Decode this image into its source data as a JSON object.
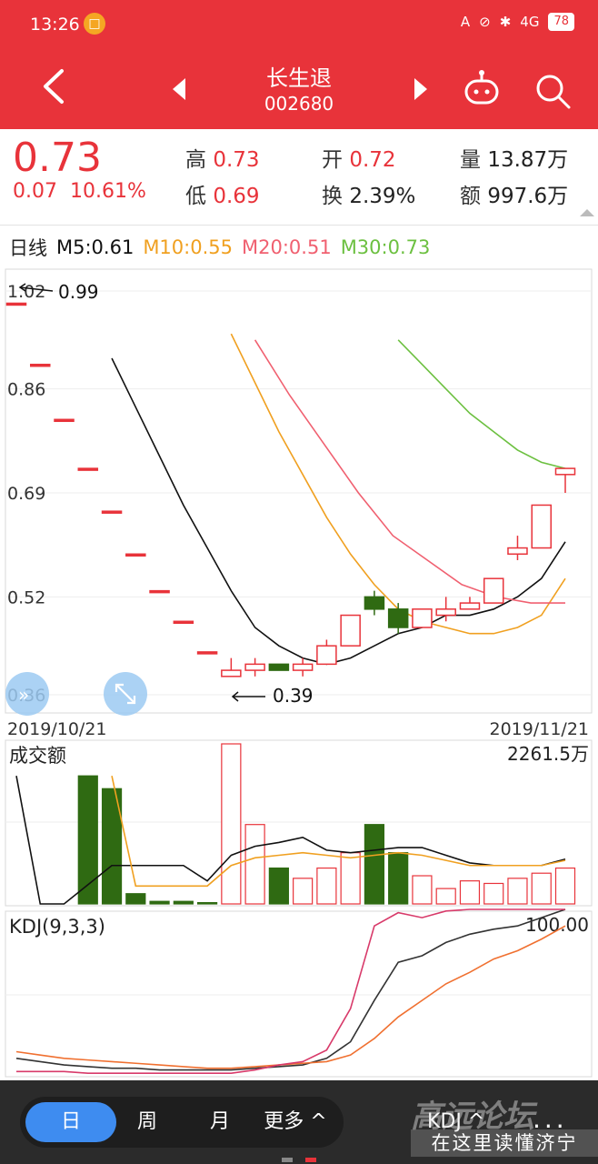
{
  "status_bar": {
    "time": "13:26",
    "battery": "78",
    "network": "4G"
  },
  "header": {
    "title": "长生退",
    "code": "002680"
  },
  "quote": {
    "price": "0.73",
    "change": "0.07",
    "change_pct": "10.61%",
    "high_label": "高",
    "high_value": "0.73",
    "low_label": "低",
    "low_value": "0.69",
    "open_label": "开",
    "open_value": "0.72",
    "turnover_label": "换",
    "turnover_value": "2.39%",
    "volume_label": "量",
    "volume_value": "13.87万",
    "amount_label": "额",
    "amount_value": "997.6万"
  },
  "ma_legend": {
    "period": "日线",
    "m5": "M5:0.61",
    "m10": "M10:0.55",
    "m20": "M20:0.51",
    "m30": "M30:0.73"
  },
  "colors": {
    "up": "#e8333a",
    "down": "#2f6a12",
    "m5": "#111111",
    "m10": "#f0a020",
    "m20": "#f06070",
    "m30": "#6cc040",
    "k": "#333333",
    "d": "#f07030",
    "j": "#d83a6a",
    "accent": "#3e8cf0"
  },
  "chart_data": {
    "type": "candlestick",
    "price_axis": {
      "ticks": [
        "1.02",
        "0.86",
        "0.69",
        "0.52",
        "0.36"
      ],
      "ylim": [
        0.36,
        1.02
      ]
    },
    "annotations": {
      "max_label": "0.99",
      "min_label": "0.39"
    },
    "dates": {
      "start": "2019/10/21",
      "end": "2019/11/21"
    },
    "candles": [
      {
        "o": 1.0,
        "h": 1.0,
        "l": 1.0,
        "c": 1.0
      },
      {
        "o": 0.9,
        "h": 0.9,
        "l": 0.9,
        "c": 0.9
      },
      {
        "o": 0.81,
        "h": 0.81,
        "l": 0.81,
        "c": 0.81
      },
      {
        "o": 0.73,
        "h": 0.73,
        "l": 0.73,
        "c": 0.73
      },
      {
        "o": 0.66,
        "h": 0.66,
        "l": 0.66,
        "c": 0.66
      },
      {
        "o": 0.59,
        "h": 0.59,
        "l": 0.59,
        "c": 0.59
      },
      {
        "o": 0.53,
        "h": 0.53,
        "l": 0.53,
        "c": 0.53
      },
      {
        "o": 0.48,
        "h": 0.48,
        "l": 0.48,
        "c": 0.48
      },
      {
        "o": 0.43,
        "h": 0.43,
        "l": 0.43,
        "c": 0.43
      },
      {
        "o": 0.39,
        "h": 0.42,
        "l": 0.39,
        "c": 0.4
      },
      {
        "o": 0.4,
        "h": 0.42,
        "l": 0.39,
        "c": 0.41
      },
      {
        "o": 0.41,
        "h": 0.41,
        "l": 0.4,
        "c": 0.4
      },
      {
        "o": 0.4,
        "h": 0.42,
        "l": 0.39,
        "c": 0.41
      },
      {
        "o": 0.41,
        "h": 0.45,
        "l": 0.41,
        "c": 0.44
      },
      {
        "o": 0.44,
        "h": 0.49,
        "l": 0.44,
        "c": 0.49
      },
      {
        "o": 0.52,
        "h": 0.53,
        "l": 0.49,
        "c": 0.5
      },
      {
        "o": 0.5,
        "h": 0.51,
        "l": 0.46,
        "c": 0.47
      },
      {
        "o": 0.47,
        "h": 0.5,
        "l": 0.47,
        "c": 0.5
      },
      {
        "o": 0.49,
        "h": 0.52,
        "l": 0.48,
        "c": 0.5
      },
      {
        "o": 0.5,
        "h": 0.52,
        "l": 0.5,
        "c": 0.51
      },
      {
        "o": 0.51,
        "h": 0.55,
        "l": 0.51,
        "c": 0.55
      },
      {
        "o": 0.59,
        "h": 0.62,
        "l": 0.58,
        "c": 0.6
      },
      {
        "o": 0.6,
        "h": 0.67,
        "l": 0.6,
        "c": 0.67
      },
      {
        "o": 0.72,
        "h": 0.73,
        "l": 0.69,
        "c": 0.73
      }
    ],
    "ma5": [
      null,
      null,
      null,
      null,
      0.91,
      0.83,
      0.75,
      0.67,
      0.6,
      0.53,
      0.47,
      0.44,
      0.42,
      0.41,
      0.42,
      0.44,
      0.46,
      0.47,
      0.49,
      0.49,
      0.5,
      0.52,
      0.55,
      0.61
    ],
    "ma10": [
      null,
      null,
      null,
      null,
      null,
      null,
      null,
      null,
      null,
      0.95,
      0.87,
      0.79,
      0.72,
      0.65,
      0.59,
      0.54,
      0.5,
      0.48,
      0.47,
      0.46,
      0.46,
      0.47,
      0.49,
      0.55
    ],
    "ma20": [
      null,
      null,
      null,
      null,
      null,
      null,
      null,
      null,
      null,
      null,
      null,
      null,
      null,
      null,
      null,
      null,
      null,
      null,
      null,
      0.94,
      0.85,
      0.77,
      0.69,
      0.62,
      0.58,
      0.54,
      0.52,
      0.51,
      0.51
    ],
    "ma30": [
      null,
      null,
      null,
      null,
      null,
      null,
      null,
      null,
      null,
      null,
      null,
      null,
      null,
      null,
      null,
      null,
      0.94,
      0.9,
      0.86,
      0.82,
      0.79,
      0.76,
      0.74,
      0.73
    ],
    "volume": {
      "title": "成交额",
      "max_label": "2261.5万",
      "values": [
        0,
        0,
        0,
        100,
        90,
        8,
        2,
        2,
        1,
        125,
        62,
        28,
        20,
        28,
        40,
        62,
        40,
        22,
        12,
        18,
        16,
        20,
        24,
        28
      ],
      "ma_line": [
        100,
        0,
        0,
        15,
        30,
        30,
        30,
        30,
        18,
        38,
        45,
        48,
        52,
        42,
        40,
        42,
        44,
        44,
        38,
        32,
        30,
        30,
        30,
        35
      ],
      "ma_line2": [
        null,
        null,
        null,
        null,
        100,
        14,
        14,
        14,
        14,
        30,
        36,
        38,
        40,
        38,
        36,
        38,
        40,
        38,
        34,
        30,
        30,
        30,
        30,
        34
      ]
    },
    "kdj": {
      "title": "KDJ(9,3,3)",
      "max_label": "100.00",
      "k": [
        10,
        8,
        6,
        5,
        4,
        4,
        3,
        3,
        3,
        3,
        4,
        5,
        6,
        10,
        20,
        45,
        68,
        72,
        80,
        85,
        88,
        90,
        95,
        100
      ],
      "d": [
        14,
        12,
        10,
        9,
        8,
        7,
        6,
        5,
        4,
        4,
        5,
        6,
        7,
        8,
        12,
        22,
        35,
        45,
        55,
        62,
        70,
        75,
        82,
        90
      ],
      "j": [
        2,
        2,
        2,
        1,
        1,
        1,
        1,
        1,
        1,
        1,
        3,
        6,
        8,
        15,
        40,
        90,
        98,
        95,
        99,
        100,
        100,
        100,
        100,
        100
      ]
    }
  },
  "bottom_bar": {
    "day": "日",
    "week": "周",
    "month": "月",
    "more": "更多 ^",
    "indicator": "KDJ ^",
    "more_dots": "...",
    "watermark_top": "高远论坛",
    "watermark_bottom": "在这里读懂济宁"
  }
}
